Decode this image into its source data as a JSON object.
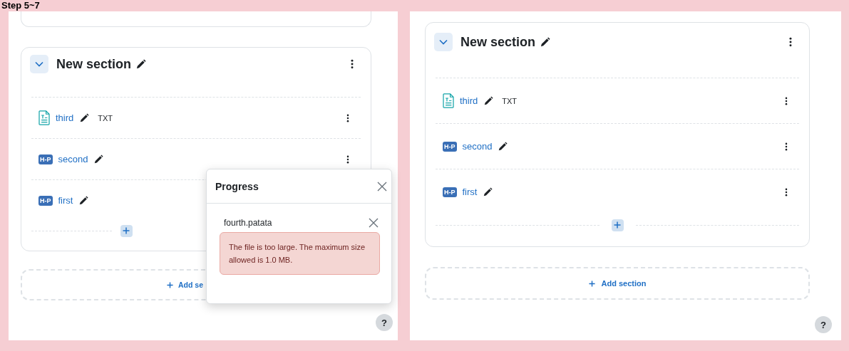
{
  "step_label": "Step 5~7",
  "panels": [
    {
      "top_card_fragment": true,
      "section": {
        "title": "New section",
        "expanded": true,
        "activities": [
          {
            "kind": "file",
            "name": "third",
            "tag": "TXT"
          },
          {
            "kind": "hp",
            "icon_label": "H-P",
            "name": "second"
          },
          {
            "kind": "hp",
            "icon_label": "H-P",
            "name": "first"
          }
        ]
      },
      "add_section": "Add se",
      "popup": {
        "title": "Progress",
        "files": [
          {
            "name": "fourth.patata",
            "error": "The file is too large. The maximum size allowed is 1.0 MB."
          }
        ]
      },
      "help": "?"
    },
    {
      "top_card_fragment": false,
      "section": {
        "title": "New section",
        "expanded": true,
        "activities": [
          {
            "kind": "file",
            "name": "third",
            "tag": "TXT"
          },
          {
            "kind": "hp",
            "icon_label": "H-P",
            "name": "second"
          },
          {
            "kind": "hp",
            "icon_label": "H-P",
            "name": "first"
          }
        ]
      },
      "add_section": "Add section",
      "help": "?"
    }
  ]
}
